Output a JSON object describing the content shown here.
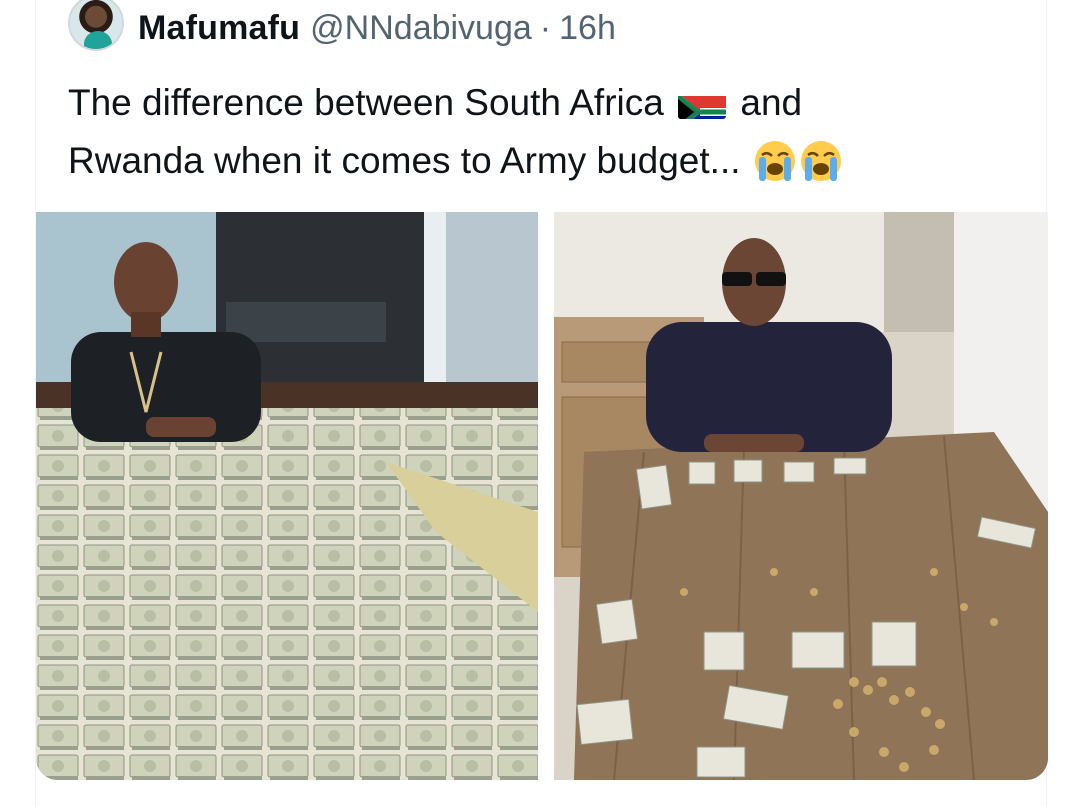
{
  "tweet": {
    "author_name": "Mafumafu",
    "author_handle": "@NNdabivuga",
    "separator": "·",
    "time": "16h",
    "text_line1_before_flag": "The difference between South Africa",
    "text_line1_after_flag": "and",
    "text_line2": "Rwanda when it comes to Army budget...",
    "flag_icon": "south-africa-flag-icon",
    "emoji_icon": "loudly-crying-face-icon"
  },
  "media": {
    "left_image": "photo-south-africa-money",
    "right_image": "photo-rwanda-money"
  },
  "colors": {
    "text": "#0f1419",
    "secondary": "#536471",
    "border": "#eff3f4"
  }
}
